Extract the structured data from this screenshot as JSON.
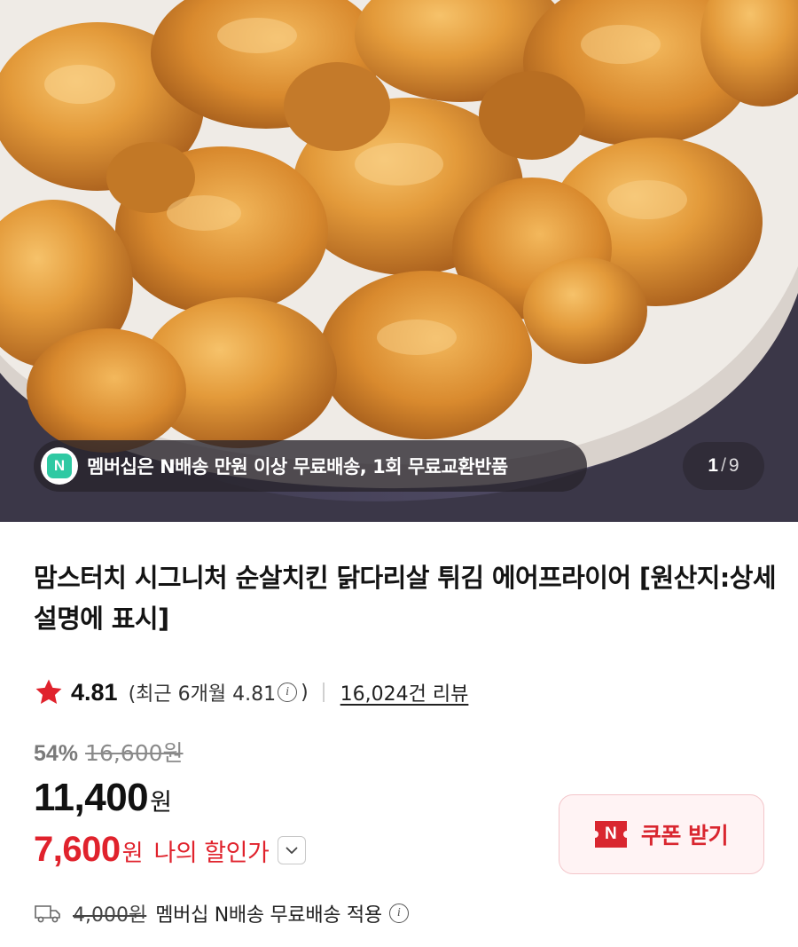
{
  "hero": {
    "image_alt": "boneless fried chicken",
    "promo_text": "멤버십은 N배송 만원 이상 무료배송, 1회 무료교환반품",
    "promo_icon": "n-delivery-icon",
    "pager_current": "1",
    "pager_separator": "/",
    "pager_total": "9"
  },
  "product": {
    "title": "맘스터치 시그니처 순살치킨 닭다리살 튀김 에어프라이어 [원산지:상세설명에 표시]"
  },
  "rating": {
    "icon": "star-icon",
    "score": "4.81",
    "recent_prefix": "(최근 6개월 4.81",
    "recent_suffix": ")",
    "reviews": "16,024건 리뷰"
  },
  "price": {
    "discount_rate": "54%",
    "original": "16,600원",
    "sale": "11,400",
    "sale_unit": "원",
    "my_price": "7,600",
    "my_unit": "원",
    "my_label": "나의 할인가"
  },
  "coupon": {
    "badge": "N",
    "label": "쿠폰 받기"
  },
  "shipping": {
    "icon": "truck-icon",
    "fee": "4,000원",
    "text": "멤버십 N배송 무료배송 적용"
  },
  "colors": {
    "accent_red": "#e0222c",
    "coupon_bg": "#fff3f4",
    "promo_green": "#2fc9a3"
  }
}
